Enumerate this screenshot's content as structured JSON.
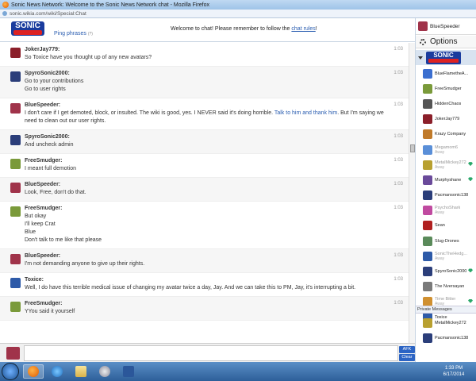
{
  "window": {
    "title": "Sonic News Network: Welcome to the Sonic News Network chat - Mozilla Firefox",
    "url": "sonic.wikia.com/wiki/Special:Chat"
  },
  "header": {
    "logo_text": "SONIC",
    "ping_label": "Ping phrases",
    "ping_badge": "(?)",
    "welcome_text": "Welcome to chat! Please remember to follow the",
    "rules_link": "chat rules",
    "welcome_suffix": "!"
  },
  "messages": [
    {
      "user": "JokerJay779:",
      "lines": [
        "So Toxice have you thought up of any new avatars?"
      ],
      "time": "1:03",
      "avatar_color": "#8b1f2a"
    },
    {
      "user": "SpyroSonic2000:",
      "lines": [
        "Go to your contributions",
        "Go to user rights"
      ],
      "time": "1:03",
      "avatar_color": "#2b3e7a"
    },
    {
      "user": "BlueSpeeder:",
      "text_before": "I don't care if I get demoted, block, or insulted. The wiki is good, yes. I NEVER said it's doing horrible. ",
      "link": "Talk to him and thank him",
      "text_after": ". But I'm saying we need to clean out our user rights.",
      "time": "1:03",
      "avatar_color": "#a0334a"
    },
    {
      "user": "SpyroSonic2000:",
      "lines": [
        "And uncheck admin"
      ],
      "time": "1:03",
      "avatar_color": "#2b3e7a"
    },
    {
      "user": "FreeSmudger:",
      "lines": [
        "I meant full demotion"
      ],
      "time": "1:03",
      "avatar_color": "#7a9a3a"
    },
    {
      "user": "BlueSpeeder:",
      "lines": [
        "Look, Free, don't do that."
      ],
      "time": "1:03",
      "avatar_color": "#a0334a"
    },
    {
      "user": "FreeSmudger:",
      "lines": [
        "But okay",
        "I'll keep Crat",
        "Blue",
        "Don't talk to me like that please"
      ],
      "time": "1:03",
      "avatar_color": "#7a9a3a"
    },
    {
      "user": "BlueSpeeder:",
      "lines": [
        "I'm not demanding anyone to give up their rights."
      ],
      "time": "1:03",
      "avatar_color": "#a0334a"
    },
    {
      "user": "Toxice:",
      "lines": [
        "Well, I do have this terrible medical issue of changing my avatar twice a day, Jay. And we can take this to PM, Jay, it's interrupting a bit."
      ],
      "time": "1:03",
      "avatar_color": "#2d5aa8"
    },
    {
      "user": "FreeSmudger:",
      "lines": [
        "YYou said it yourself"
      ],
      "time": "1:03",
      "avatar_color": "#7a9a3a"
    }
  ],
  "input": {
    "value": "",
    "afk_label": "AFK",
    "clear_label": "Clear"
  },
  "sidebar": {
    "me": "BlueSpeeder",
    "options_label": "Options",
    "room_logo": "SONIC",
    "users": [
      {
        "name": "BlueFlametheA...",
        "away": false,
        "mod": false,
        "color": "#3b6fd0"
      },
      {
        "name": "FreeSmudger",
        "away": false,
        "mod": false,
        "color": "#7a9a3a"
      },
      {
        "name": "HiddenChaos",
        "away": false,
        "mod": false,
        "color": "#555555"
      },
      {
        "name": "JokerJay779",
        "away": false,
        "mod": false,
        "color": "#8b1f2a"
      },
      {
        "name": "Krazy Company",
        "away": false,
        "mod": false,
        "color": "#c07a2a"
      },
      {
        "name": "Megamom6",
        "away": true,
        "mod": false,
        "color": "#5a8fd8"
      },
      {
        "name": "MetalMickey272",
        "away": true,
        "mod": true,
        "color": "#b8a030"
      },
      {
        "name": "Murphyshane",
        "away": false,
        "mod": true,
        "color": "#6a4a9a"
      },
      {
        "name": "Pacmansonic138",
        "away": false,
        "mod": false,
        "color": "#2b3e7a"
      },
      {
        "name": "PsychoShark",
        "away": true,
        "mod": false,
        "color": "#c04aa0"
      },
      {
        "name": "Sean",
        "away": false,
        "mod": false,
        "color": "#b02020"
      },
      {
        "name": "Slug-Drones",
        "away": false,
        "mod": false,
        "color": "#5a8a5a"
      },
      {
        "name": "SonicTheHedg...",
        "away": true,
        "mod": false,
        "color": "#2d5aa8"
      },
      {
        "name": "SpyroSonic2000",
        "away": false,
        "mod": true,
        "color": "#2b3e7a"
      },
      {
        "name": "The Nversayan",
        "away": false,
        "mod": false,
        "color": "#7a7a7a"
      },
      {
        "name": "Time Bitter",
        "away": true,
        "mod": true,
        "color": "#d09030"
      },
      {
        "name": "Toxice",
        "away": false,
        "mod": false,
        "color": "#2d5aa8"
      }
    ],
    "away_label": "Away",
    "pm_header": "Private Messages",
    "pms": [
      {
        "name": "MetalMickey272",
        "color": "#b8a030"
      },
      {
        "name": "Pacmansonic138",
        "color": "#2b3e7a"
      }
    ]
  },
  "taskbar": {
    "time": "1:33 PM",
    "date": "6/17/2014"
  }
}
